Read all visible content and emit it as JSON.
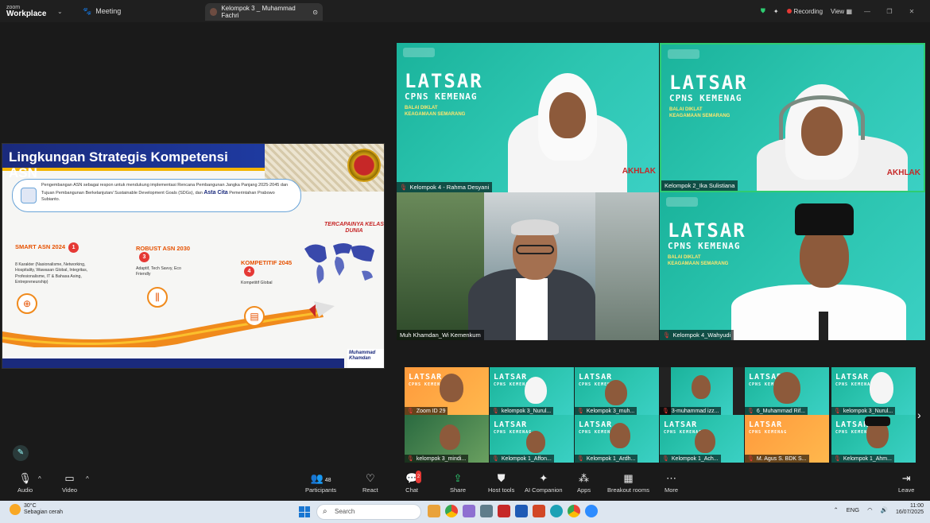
{
  "titlebar": {
    "brand_top": "zoom",
    "brand_main": "Workplace",
    "meeting_label": "Meeting",
    "tab_title": "Kelompok 3 _ Muhammad Fachri",
    "recording_label": "Recording",
    "view_label": "View"
  },
  "slide": {
    "title": "Lingkungan Strategis Kompetensi ASN",
    "info_text": "Pengembangan ASN sebagai respon untuk mendukung implementasi Rencana Pembangunan Jangka Panjang 2025-2045 dan Tujuan Pembangunan Berkelanjutan/ Sustainable Development Goals (SDGs), dan",
    "info_bold": "Asta Cita",
    "info_tail": "Pemerintahan Prabowo Subianto.",
    "m1_title": "SMART ASN 2024",
    "m1_num": "1",
    "m1_desc": "8 Karakter (Nasionalisme, Networking, Hospitality, Wawasan Global, Integritas, Profesionalisme, IT & Bahasa Asing, Entrepreneurship)",
    "m3_title": "ROBUST ASN 2030",
    "m3_num": "3",
    "m3_desc": "Adaptif, Tech Savvy, Eco Friendly",
    "m4_title": "KOMPETITIF 2045",
    "m4_num": "4",
    "m4_desc": "Kompetitif Global",
    "goal": "TERCAPAINYA KELAS DUNIA",
    "signature": "Muhammad Khamdan"
  },
  "tiles": {
    "latsar_l1": "LATSAR",
    "latsar_l2": "CPNS KEMENAG",
    "latsar_l3": "BALAI DIKLAT KEAGAMAAN SEMARANG",
    "t1_name": "Kelompok 4 - Rahma Desyani",
    "t2_name": "Kelompok 2_Ika Sulistiana",
    "t3_name": "Muh Khamdan_Wi Kemenkum",
    "t4_name": "Kelompok 4_Wahyudi",
    "akhlak": "AKHLAK"
  },
  "gallery": [
    "Zoom ID 29",
    "kelompok 3_Nurul...",
    "Kelompok 3_muh...",
    "3-muhammad izz...",
    "6_Muhammad Rif...",
    "kelompok 3_Nurul...",
    "kelompok 3_mindi...",
    "Kelompok 1_Affon...",
    "Kelompok 1_Ardh...",
    "Kelompok 1_Ach...",
    "M. Agus S. BDK S...",
    "Kelompok 1_Ahm..."
  ],
  "toolbar": {
    "audio": "Audio",
    "video": "Video",
    "participants": "Participants",
    "participants_count": "48",
    "react": "React",
    "chat": "Chat",
    "chat_badge": "2",
    "share": "Share",
    "host_tools": "Host tools",
    "ai_companion": "AI Companion",
    "apps": "Apps",
    "breakout": "Breakout rooms",
    "more": "More",
    "leave": "Leave"
  },
  "taskbar": {
    "temp": "30°C",
    "weather": "Sebagian cerah",
    "weather_badge": "6",
    "search_placeholder": "Search",
    "lang": "ENG",
    "time": "11:00",
    "date": "16/07/2025"
  }
}
